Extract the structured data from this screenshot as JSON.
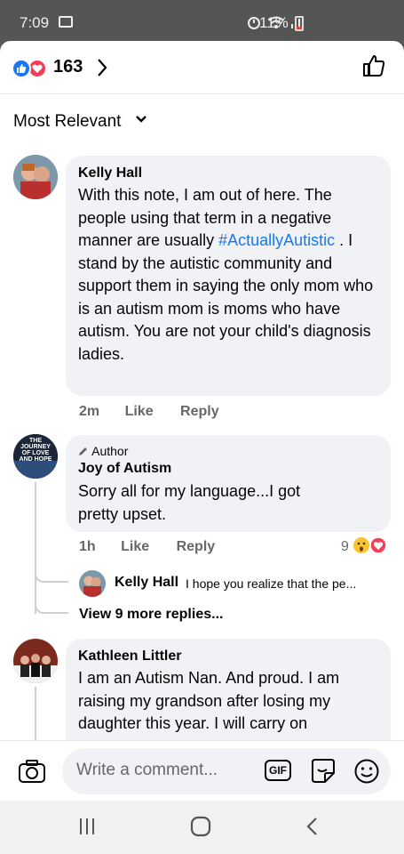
{
  "status_bar": {
    "time": "7:09",
    "battery": "11%"
  },
  "reactions": {
    "count": "163"
  },
  "sort": {
    "label": "Most Relevant"
  },
  "comments": [
    {
      "author": "Kelly Hall",
      "text_before": "With this note, I am out of here. The people using that term in a negative manner are usually ",
      "hashtag": "#ActuallyAutistic",
      "text_after": " . I stand by the autistic community and support them in saying the only mom who is an autism mom is moms who have autism. You are not your child's diagnosis ladies.",
      "time": "2m",
      "like": "Like",
      "reply": "Reply"
    },
    {
      "author_badge": "Author",
      "author": "Joy of Autism",
      "avatar_text": "THE JOURNEY OF LOVE AND HOPE",
      "text": "Sorry all for my language...I got pretty upset.",
      "time": "1h",
      "like": "Like",
      "reply": "Reply",
      "reaction_count": "9",
      "reply_preview": {
        "author": "Kelly Hall",
        "text": "I hope you realize that the pe..."
      },
      "view_more": "View 9 more replies..."
    },
    {
      "author": "Kathleen Littler",
      "text": "I am  an Autism  Nan. And proud. I am raising  my grandson  after losing my daughter this year.  I will carry on"
    }
  ],
  "composer": {
    "placeholder": "Write a comment...",
    "gif_label": "GIF"
  }
}
